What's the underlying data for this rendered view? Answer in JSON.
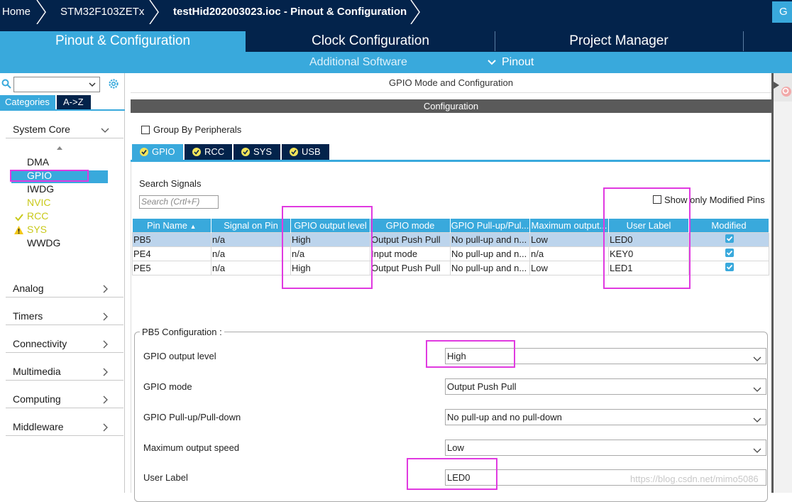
{
  "breadcrumb": {
    "home": "Home",
    "device": "STM32F103ZETx",
    "project": "testHid202003023.ioc - Pinout & Configuration",
    "generate": "G"
  },
  "main_tabs": [
    {
      "label": "Pinout & Configuration",
      "active": true
    },
    {
      "label": "Clock Configuration",
      "active": false
    },
    {
      "label": "Project Manager",
      "active": false
    }
  ],
  "sub_menu": {
    "additional_software": "Additional Software",
    "pinout": "Pinout"
  },
  "left_panel": {
    "search_placeholder": "",
    "tabs": {
      "categories": "Categories",
      "az": "A->Z"
    },
    "groups": [
      {
        "label": "System Core",
        "expanded": true
      },
      {
        "label": "Analog"
      },
      {
        "label": "Timers"
      },
      {
        "label": "Connectivity"
      },
      {
        "label": "Multimedia"
      },
      {
        "label": "Computing"
      },
      {
        "label": "Middleware"
      }
    ],
    "system_core_items": [
      {
        "label": "DMA",
        "state": "normal"
      },
      {
        "label": "GPIO",
        "state": "selected"
      },
      {
        "label": "IWDG",
        "state": "normal"
      },
      {
        "label": "NVIC",
        "state": "yellow"
      },
      {
        "label": "RCC",
        "state": "ok"
      },
      {
        "label": "SYS",
        "state": "warning"
      },
      {
        "label": "WWDG",
        "state": "normal"
      }
    ]
  },
  "right_panel": {
    "title": "GPIO Mode and Configuration",
    "config_header": "Configuration",
    "group_by_peripherals": "Group By Peripherals",
    "peripheral_tabs": [
      "GPIO",
      "RCC",
      "SYS",
      "USB"
    ],
    "search_signals_label": "Search Signals",
    "search_signals_placeholder": "Search (Crtl+F)",
    "show_only_modified": "Show only Modified Pins",
    "table": {
      "headers": [
        "Pin Name",
        "Signal on Pin",
        "GPIO output level",
        "GPIO mode",
        "GPIO Pull-up/Pul...",
        "Maximum output...",
        "User Label",
        "Modified"
      ],
      "rows": [
        [
          "PB5",
          "n/a",
          "High",
          "Output Push Pull",
          "No pull-up and n...",
          "Low",
          "LED0"
        ],
        [
          "PE4",
          "n/a",
          "n/a",
          "Input mode",
          "No pull-up and n...",
          "n/a",
          "KEY0"
        ],
        [
          "PE5",
          "n/a",
          "High",
          "Output Push Pull",
          "No pull-up and n...",
          "Low",
          "LED1"
        ]
      ],
      "modified": [
        true,
        true,
        true
      ]
    },
    "pin_config": {
      "legend": "PB5 Configuration :",
      "fields": [
        {
          "label": "GPIO output level",
          "value": "High"
        },
        {
          "label": "GPIO mode",
          "value": "Output Push Pull"
        },
        {
          "label": "GPIO Pull-up/Pull-down",
          "value": "No pull-up and no pull-down"
        },
        {
          "label": "Maximum output speed",
          "value": "Low"
        },
        {
          "label": "User Label",
          "value": "LED0"
        }
      ]
    }
  },
  "watermark": "https://blog.csdn.net/mimo5086",
  "colors": {
    "navy": "#03234b",
    "accent": "#39a9dc",
    "highlight": "#e03ae0"
  }
}
